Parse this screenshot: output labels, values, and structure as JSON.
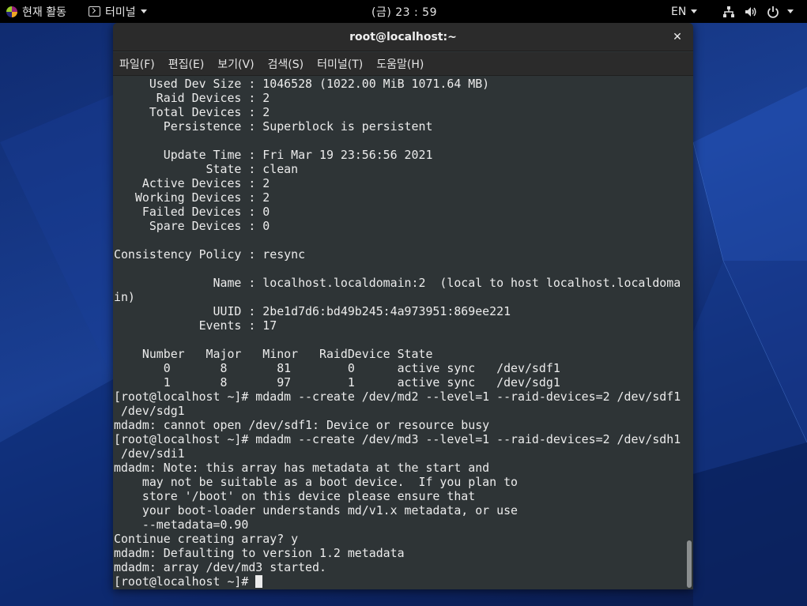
{
  "topbar": {
    "activities_label": "현재 활동",
    "app_label": "터미널",
    "clock": "(금) 23 : 59",
    "language": "EN"
  },
  "window": {
    "title": "root@localhost:~",
    "close_glyph": "✕"
  },
  "menubar": {
    "items": [
      {
        "label": "파일(F)"
      },
      {
        "label": "편집(E)"
      },
      {
        "label": "보기(V)"
      },
      {
        "label": "검색(S)"
      },
      {
        "label": "터미널(T)"
      },
      {
        "label": "도움말(H)"
      }
    ]
  },
  "terminal": {
    "lines": [
      "     Used Dev Size : 1046528 (1022.00 MiB 1071.64 MB)",
      "      Raid Devices : 2",
      "     Total Devices : 2",
      "       Persistence : Superblock is persistent",
      "",
      "       Update Time : Fri Mar 19 23:56:56 2021",
      "             State : clean",
      "    Active Devices : 2",
      "   Working Devices : 2",
      "    Failed Devices : 0",
      "     Spare Devices : 0",
      "",
      "Consistency Policy : resync",
      "",
      "              Name : localhost.localdomain:2  (local to host localhost.localdoma",
      "in)",
      "              UUID : 2be1d7d6:bd49b245:4a973951:869ee221",
      "            Events : 17",
      "",
      "    Number   Major   Minor   RaidDevice State",
      "       0       8       81        0      active sync   /dev/sdf1",
      "       1       8       97        1      active sync   /dev/sdg1",
      "[root@localhost ~]# mdadm --create /dev/md2 --level=1 --raid-devices=2 /dev/sdf1",
      " /dev/sdg1",
      "mdadm: cannot open /dev/sdf1: Device or resource busy",
      "[root@localhost ~]# mdadm --create /dev/md3 --level=1 --raid-devices=2 /dev/sdh1",
      " /dev/sdi1",
      "mdadm: Note: this array has metadata at the start and",
      "    may not be suitable as a boot device.  If you plan to",
      "    store '/boot' on this device please ensure that",
      "    your boot-loader understands md/v1.x metadata, or use",
      "    --metadata=0.90",
      "Continue creating array? y",
      "mdadm: Defaulting to version 1.2 metadata",
      "mdadm: array /dev/md3 started."
    ],
    "prompt": "[root@localhost ~]# "
  },
  "colors": {
    "terminal_bg": "#2e3436",
    "terminal_fg": "#ececec",
    "topbar_bg": "#000000",
    "desktop_accent": "#1a3f93"
  }
}
